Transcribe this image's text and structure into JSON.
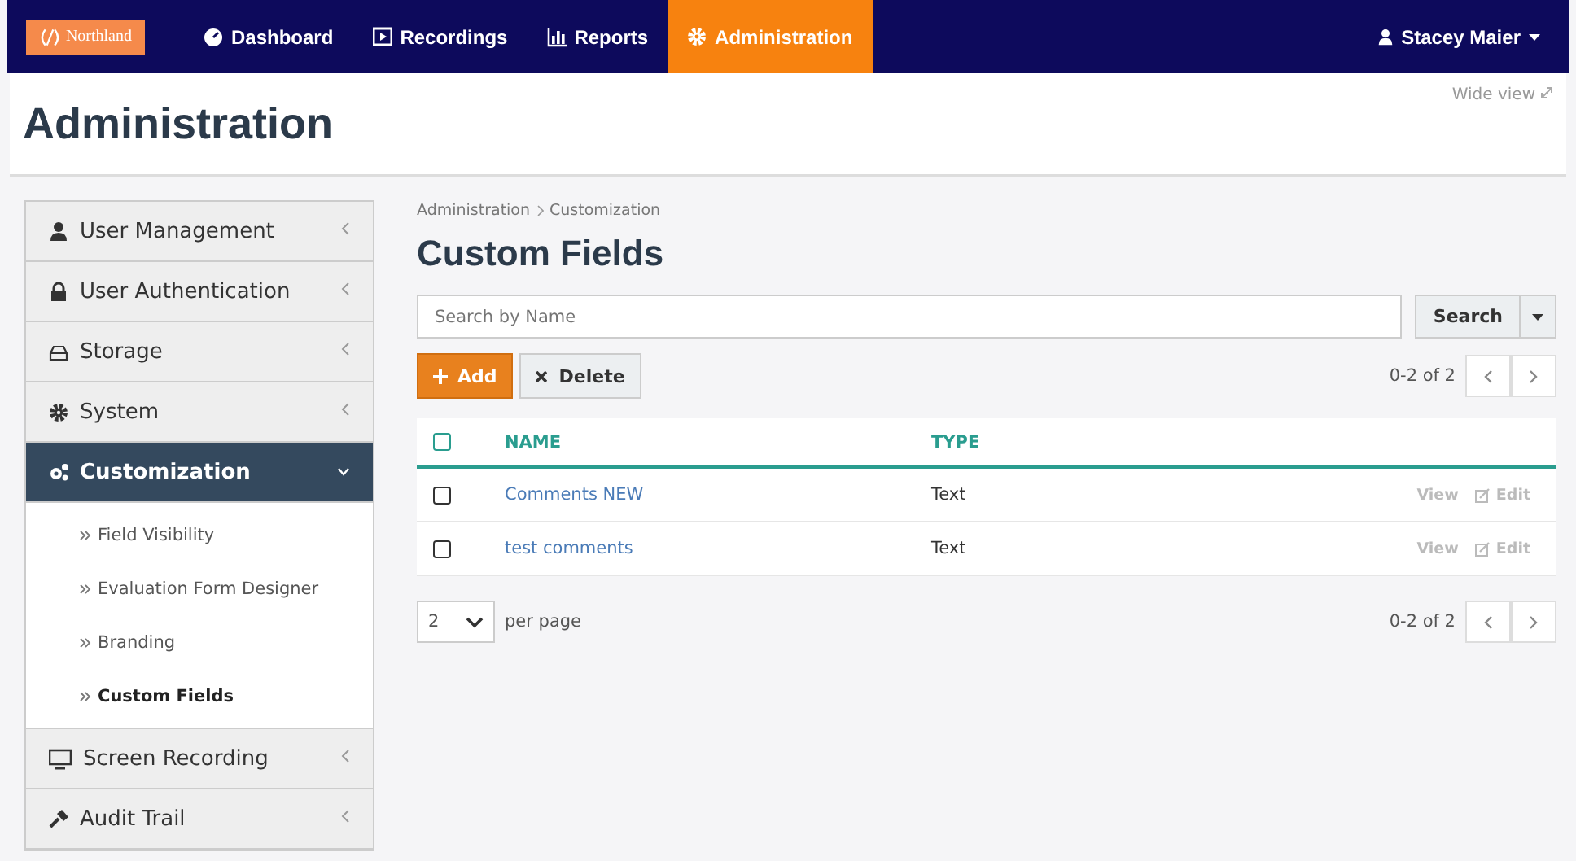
{
  "nav": {
    "logo": "Northland",
    "items": [
      {
        "label": "Dashboard",
        "selected": false
      },
      {
        "label": "Recordings",
        "selected": false
      },
      {
        "label": "Reports",
        "selected": false
      },
      {
        "label": "Administration",
        "selected": true
      }
    ],
    "user": "Stacey Maier"
  },
  "header": {
    "title": "Administration",
    "wide_view": "Wide view"
  },
  "sidebar": {
    "items": [
      {
        "label": "User Management",
        "selected": false,
        "expanded": false
      },
      {
        "label": "User Authentication",
        "selected": false,
        "expanded": false
      },
      {
        "label": "Storage",
        "selected": false,
        "expanded": false
      },
      {
        "label": "System",
        "selected": false,
        "expanded": false
      },
      {
        "label": "Customization",
        "selected": true,
        "expanded": true,
        "children": [
          {
            "label": "Field Visibility",
            "selected": false
          },
          {
            "label": "Evaluation Form Designer",
            "selected": false
          },
          {
            "label": "Branding",
            "selected": false
          },
          {
            "label": "Custom Fields",
            "selected": true
          }
        ]
      },
      {
        "label": "Screen Recording",
        "selected": false,
        "expanded": false
      },
      {
        "label": "Audit Trail",
        "selected": false,
        "expanded": false
      }
    ]
  },
  "breadcrumb": [
    "Administration",
    "Customization"
  ],
  "page_title": "Custom Fields",
  "search": {
    "placeholder": "Search by Name",
    "button": "Search"
  },
  "actions": {
    "add": "Add",
    "delete": "Delete"
  },
  "pager_top": "0-2 of 2",
  "table": {
    "all_checked": false,
    "columns": [
      "NAME",
      "TYPE"
    ],
    "rows": [
      {
        "name": "Comments NEW",
        "type": "Text",
        "checked": false,
        "view": "View",
        "edit": "Edit"
      },
      {
        "name": "test comments",
        "type": "Text",
        "checked": false,
        "view": "View",
        "edit": "Edit"
      }
    ]
  },
  "per_page": {
    "value": "2",
    "label": "per page"
  },
  "pager_bottom": "0-2 of 2"
}
